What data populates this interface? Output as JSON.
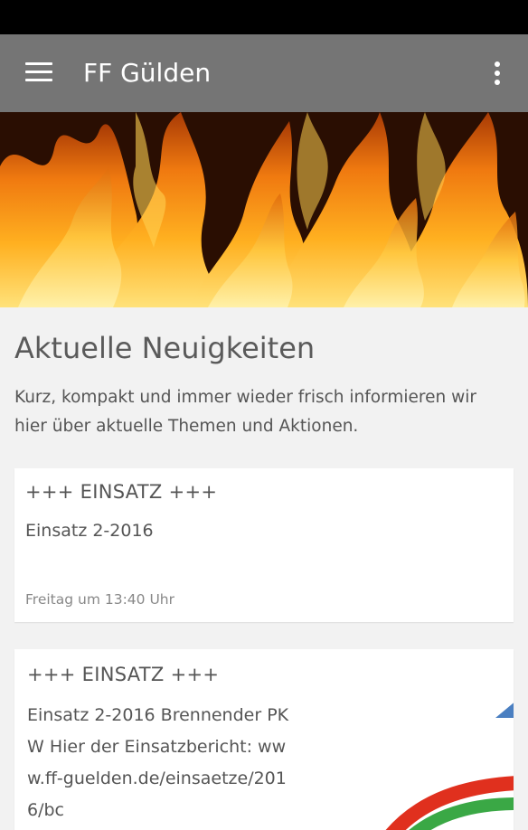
{
  "app_bar": {
    "title": "FF Gülden",
    "background": "#757575",
    "menu_icon": "hamburger-menu-icon",
    "overflow_icon": "more-vertical-icon"
  },
  "hero": {
    "icon": "fire-banner-image"
  },
  "section": {
    "title": "Aktuelle Neuigkeiten",
    "description": "Kurz, kompakt und immer wieder frisch informieren wir hier über aktuelle Themen und Aktionen."
  },
  "news": [
    {
      "title": "+++ EINSATZ +++",
      "text": "Einsatz 2-2016",
      "date": "Freitag um 13:40 Uhr"
    },
    {
      "title": "+++ EINSATZ +++",
      "text": "Einsatz 2-2016 Brennender PKW Hier der Einsatzbericht: www.ff-guelden.de/einsaetze/2016/bc"
    }
  ]
}
